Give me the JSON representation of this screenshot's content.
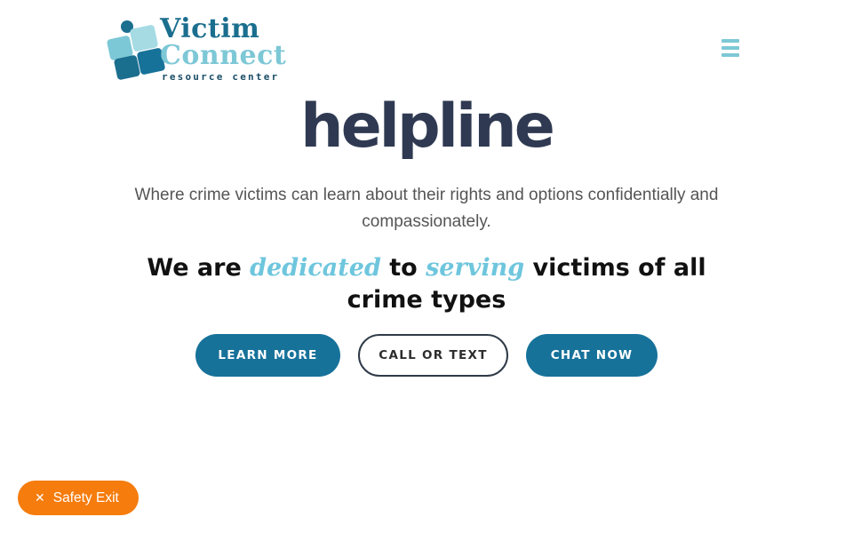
{
  "header": {
    "logo": {
      "line1": "Victim",
      "line2": "Connect",
      "line3": "resource center",
      "colors": {
        "dark": "#1a6e8e",
        "light": "#7dc8d6",
        "navy": "#1a4d66"
      }
    },
    "menu_icon": "hamburger-menu-icon"
  },
  "hero": {
    "title": "helpline",
    "subtitle": "Where crime victims can learn about their rights and options confidentially and compassionately.",
    "tagline": {
      "part1": "We are ",
      "accent1": "dedicated",
      "part2": " to ",
      "accent2": "serving",
      "part3": " victims of all crime types"
    }
  },
  "buttons": {
    "learn_more": "LEARN MORE",
    "call_or_text": "CALL OR TEXT",
    "chat_now": "CHAT NOW"
  },
  "safety_exit": {
    "label": "Safety Exit",
    "icon": "close-icon",
    "color": "#f57c0d"
  },
  "colors": {
    "primary": "#17729a",
    "accent": "#6ec6dd",
    "title": "#2f3a52"
  }
}
